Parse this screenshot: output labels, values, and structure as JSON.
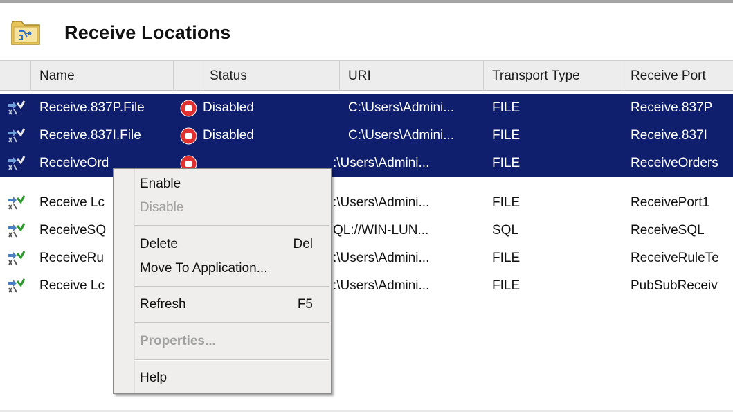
{
  "header": {
    "title": "Receive Locations"
  },
  "columns": {
    "name": "Name",
    "status": "Status",
    "uri": "URI",
    "transport": "Transport Type",
    "port": "Receive Port"
  },
  "rows": [
    {
      "name": "Receive.837P.File",
      "status": "Disabled",
      "uri": "C:\\Users\\Admini...",
      "transport": "FILE",
      "port": "Receive.837P",
      "selected": true
    },
    {
      "name": "Receive.837I.File",
      "status": "Disabled",
      "uri": "C:\\Users\\Admini...",
      "transport": "FILE",
      "port": "Receive.837I",
      "selected": true
    },
    {
      "name": "ReceiveOrd",
      "status": "",
      "uri": ":\\Users\\Admini...",
      "transport": "FILE",
      "port": "ReceiveOrders",
      "selected": true
    },
    {
      "name": "Receive Lc",
      "status": "",
      "uri": ":\\Users\\Admini...",
      "transport": "FILE",
      "port": "ReceivePort1",
      "selected": false
    },
    {
      "name": "ReceiveSQ",
      "status": "",
      "uri": "QL://WIN-LUN...",
      "transport": "SQL",
      "port": "ReceiveSQL",
      "selected": false
    },
    {
      "name": "ReceiveRu",
      "status": "",
      "uri": ":\\Users\\Admini...",
      "transport": "FILE",
      "port": "ReceiveRuleTe",
      "selected": false
    },
    {
      "name": "Receive Lc",
      "status": "",
      "uri": ":\\Users\\Admini...",
      "transport": "FILE",
      "port": "PubSubReceiv",
      "selected": false
    }
  ],
  "context_menu": {
    "enable": "Enable",
    "disable": "Disable",
    "delete": "Delete",
    "delete_key": "Del",
    "move": "Move To Application...",
    "refresh": "Refresh",
    "refresh_key": "F5",
    "properties": "Properties...",
    "help": "Help"
  },
  "colors": {
    "selection": "#0f1f6d",
    "status_disabled": "#e03030"
  }
}
